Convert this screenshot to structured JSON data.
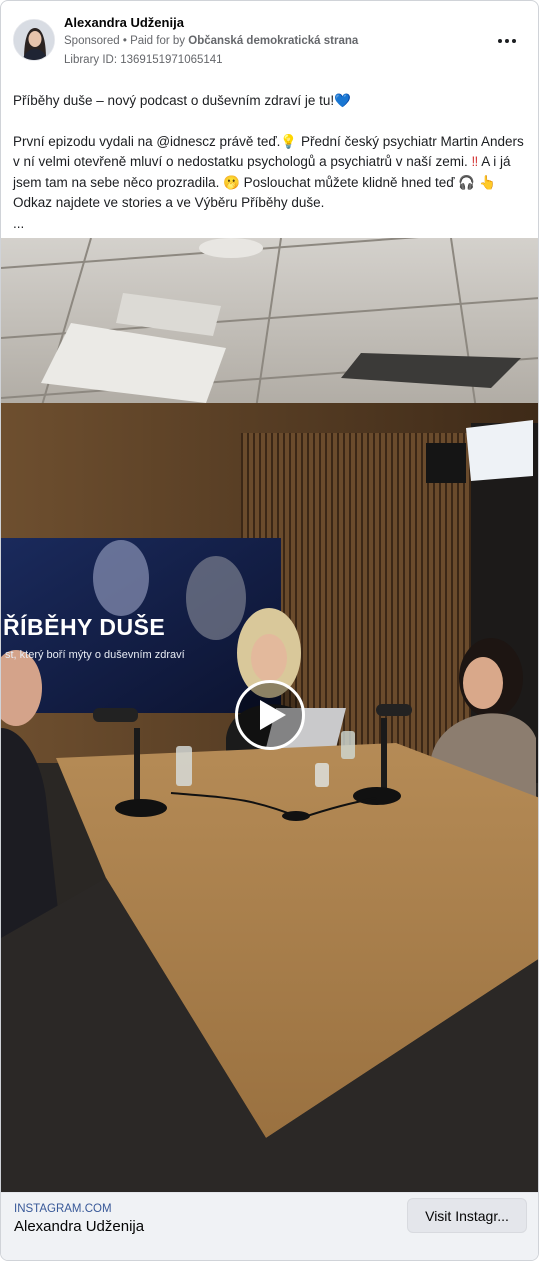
{
  "advertiser": {
    "name": "Alexandra Udženija",
    "sponsored_label": "Sponsored",
    "paid_for_prefix": "Paid for by",
    "paid_for_by": "Občanská demokratická strana",
    "library_id": "Library ID: 1369151971065141"
  },
  "post": {
    "line1": "Příběhy duše – nový podcast o duševním zdraví je tu!",
    "line1_emoji": "💙",
    "para2_a": "První epizodu vydali na @idnescz právě teď.",
    "para2_b": " Přední český psychiatr Martin Anders v ní velmi otevřeně mluví o nedostatku psychologů a psychiatrů v naší zemi. ",
    "para2_c": " A i já jsem tam na sebe něco prozradila. ",
    "para2_d": " Poslouchat můžete klidně hned teď ",
    "para2_e": " Odkaz najdete ve stories a ve Výběru Příběhy duše.",
    "ellipsis": "..."
  },
  "media": {
    "screen_title": "ŘÍBĚHY DUŠE",
    "screen_subtitle": "st, který boří mýty o duševním zdraví"
  },
  "footer": {
    "domain": "INSTAGRAM.COM",
    "title": "Alexandra Udženija",
    "cta_label": "Visit Instagr..."
  },
  "icons": {
    "more": "more-horizontal-icon",
    "play": "play-icon"
  }
}
